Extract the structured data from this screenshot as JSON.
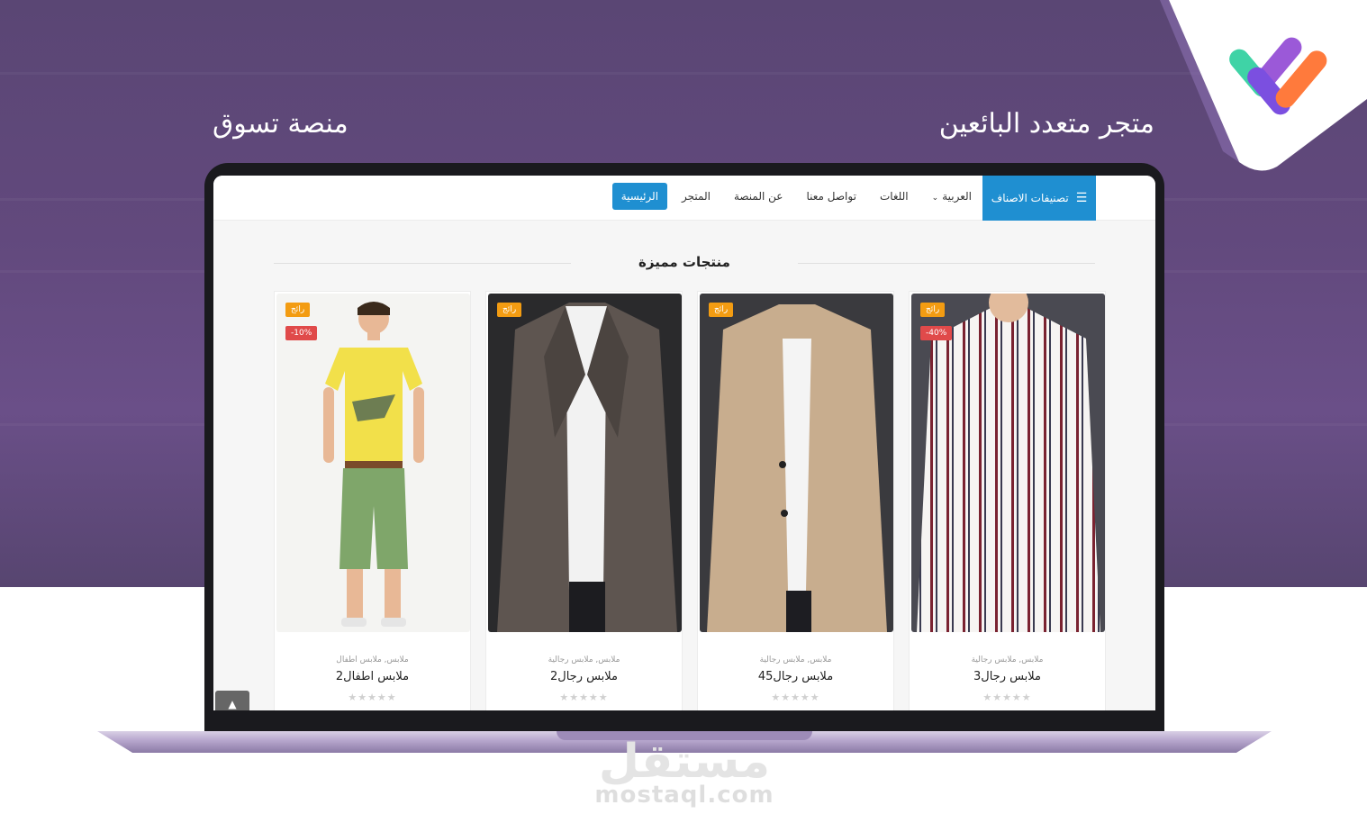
{
  "hero": {
    "title_right": "متجر متعدد البائعين",
    "title_left": "منصة تسوق"
  },
  "navbar": {
    "categories_button": "تصنيفات الاصناف",
    "categories_icon": "menu-icon",
    "items": [
      {
        "label": "الرئيسية",
        "active": true
      },
      {
        "label": "المتجر",
        "active": false
      },
      {
        "label": "عن المنصة",
        "active": false
      },
      {
        "label": "تواصل معنا",
        "active": false
      },
      {
        "label": "اللغات",
        "active": false
      },
      {
        "label": "العربية",
        "active": false,
        "dropdown": true
      }
    ],
    "accent_color": "#1f8fd1"
  },
  "section": {
    "title": "منتجات مميزة"
  },
  "products": [
    {
      "hot_badge": "رائج",
      "sale_badge": "40%-",
      "category": "ملابس, ملابس رجالية",
      "name": "ملابس رجال3",
      "stars": "★★★★★"
    },
    {
      "hot_badge": "رائج",
      "sale_badge": "",
      "category": "ملابس, ملابس رجالية",
      "name": "ملابس رجال45",
      "stars": "★★★★★"
    },
    {
      "hot_badge": "رائج",
      "sale_badge": "",
      "category": "ملابس, ملابس رجالية",
      "name": "ملابس رجال2",
      "stars": "★★★★★"
    },
    {
      "hot_badge": "رائج",
      "sale_badge": "10%-",
      "category": "ملابس, ملابس اطفال",
      "name": "ملابس اطفال2",
      "stars": "★★★★★"
    }
  ],
  "watermark": {
    "arabic": "مستقل",
    "latin": "mostaql.com"
  },
  "colors": {
    "hero_bg": "#62497d",
    "hot_badge": "#f39c12",
    "sale_badge": "#e04a4a"
  }
}
